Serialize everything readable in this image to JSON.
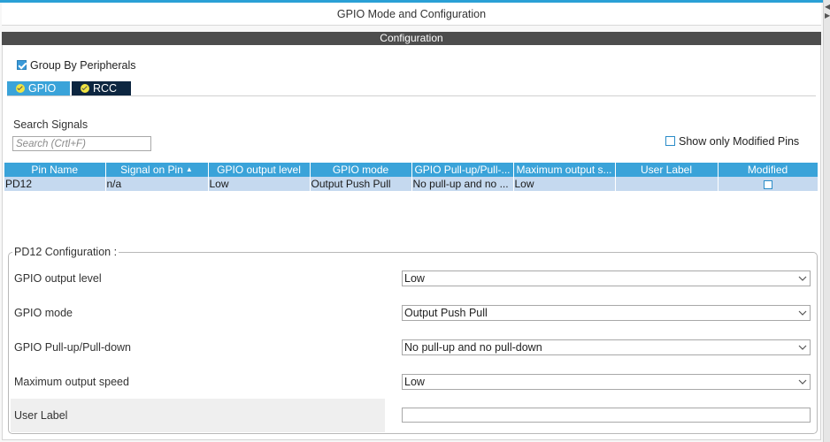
{
  "window": {
    "title": "GPIO Mode and Configuration"
  },
  "config_header": "Configuration",
  "group_by": {
    "label": "Group By Peripherals",
    "checked": true
  },
  "tabs": [
    {
      "label": "GPIO",
      "status_icon": "check-circle-icon",
      "active": true
    },
    {
      "label": "RCC",
      "status_icon": "check-circle-icon",
      "active": false
    }
  ],
  "search": {
    "label": "Search Signals",
    "placeholder": "Search (Crtl+F)",
    "value": ""
  },
  "show_modified": {
    "label": "Show only Modified Pins",
    "checked": false
  },
  "table": {
    "columns": [
      "Pin Name",
      "Signal on Pin",
      "GPIO output level",
      "GPIO mode",
      "GPIO Pull-up/Pull-...",
      "Maximum output s...",
      "User Label",
      "Modified"
    ],
    "sorted_column": "Signal on Pin",
    "rows": [
      {
        "pin": "PD12",
        "signal": "n/a",
        "level": "Low",
        "mode": "Output Push Pull",
        "pull": "No pull-up and no ...",
        "speed": "Low",
        "user_label": "",
        "modified": false
      }
    ]
  },
  "config": {
    "title": "PD12 Configuration :",
    "fields": [
      {
        "label": "GPIO output level",
        "value": "Low"
      },
      {
        "label": "GPIO mode",
        "value": "Output Push Pull"
      },
      {
        "label": "GPIO Pull-up/Pull-down",
        "value": "No pull-up and no pull-down"
      },
      {
        "label": "Maximum output speed",
        "value": "Low"
      }
    ],
    "user_label": {
      "label": "User Label",
      "value": ""
    }
  },
  "colors": {
    "accent": "#3aa3d9",
    "header_dark": "#4d4d4d",
    "tab_dark": "#0d2640",
    "row_selected": "#c5d9ef"
  }
}
